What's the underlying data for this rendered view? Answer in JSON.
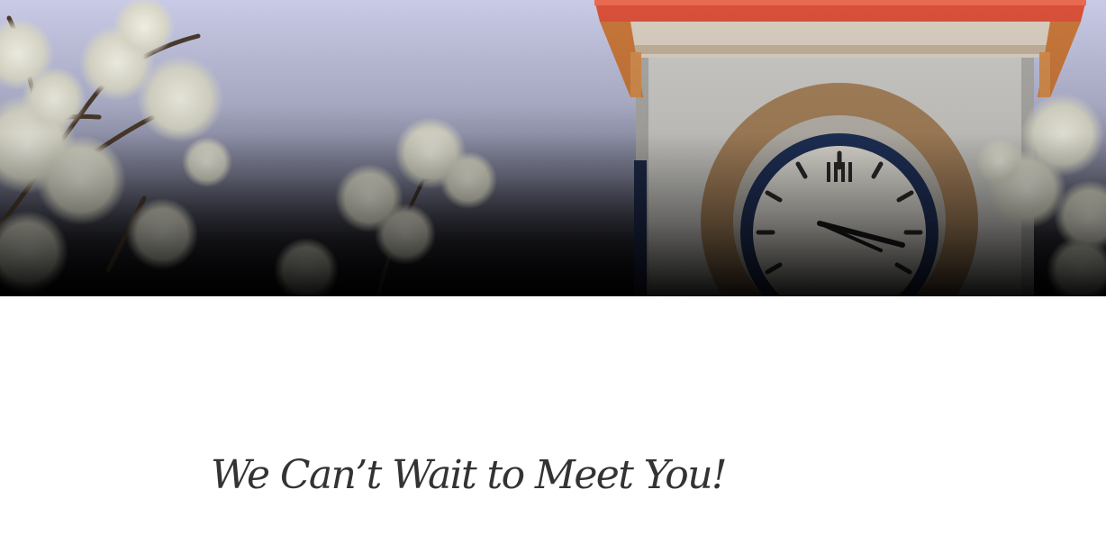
{
  "hero": {
    "image": "clock-tower-with-blossoms"
  },
  "main": {
    "heading": "We Can’t Wait to Meet You!"
  }
}
